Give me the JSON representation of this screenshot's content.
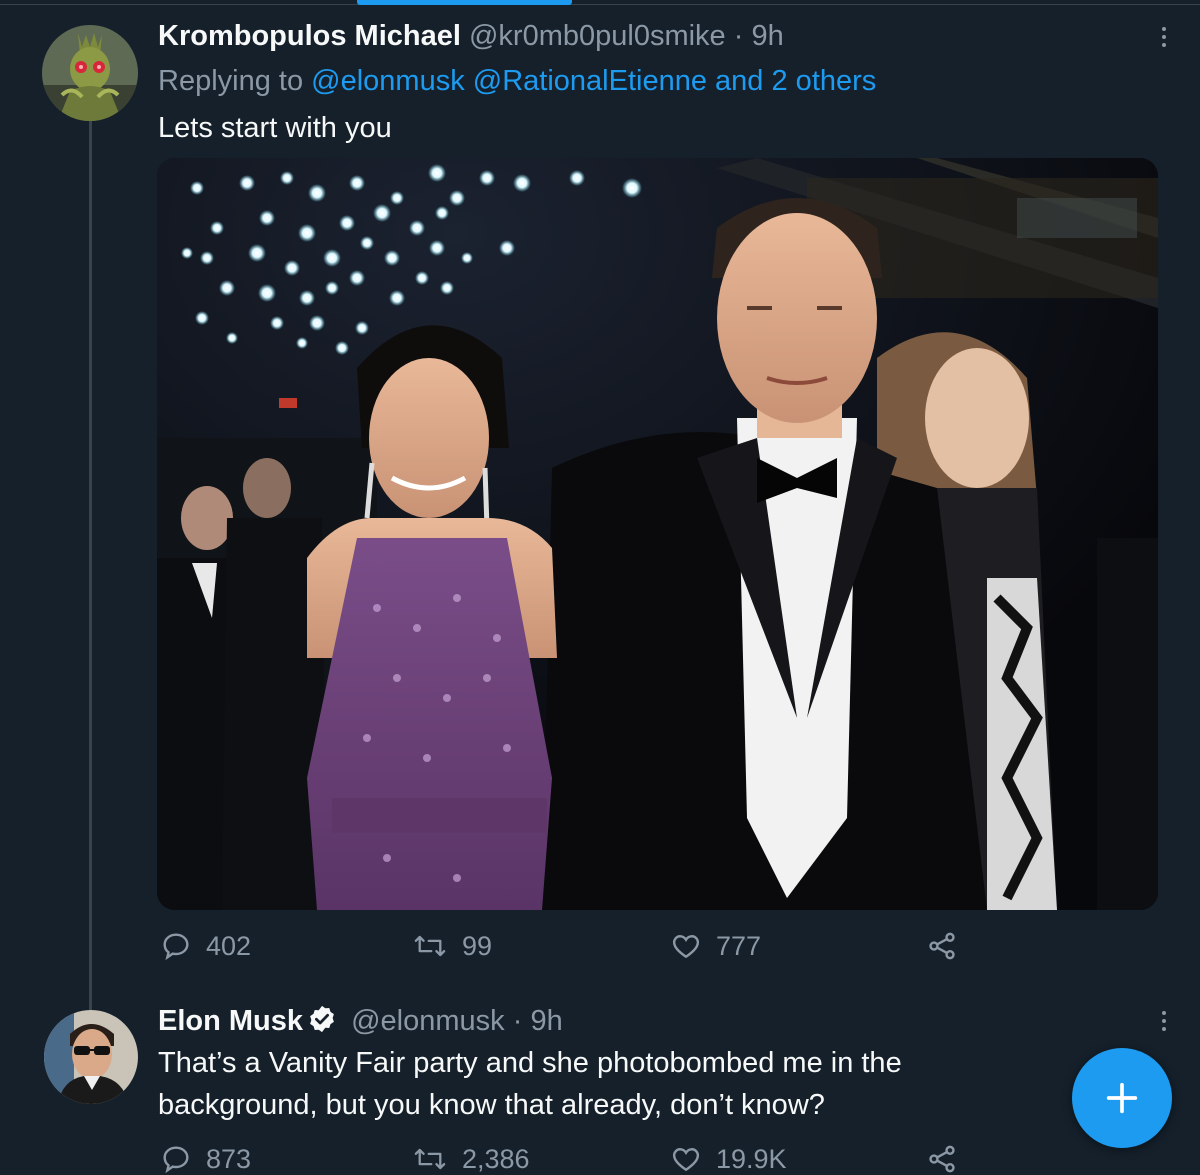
{
  "tweet1": {
    "display_name": "Krombopulos Michael",
    "handle": "@kr0mb0pul0smike",
    "separator": "·",
    "time": "9h",
    "replying_prefix": "Replying to",
    "replying_mention1": "@elonmusk",
    "replying_mention2": "@RationalEtienne",
    "replying_and": "and",
    "replying_others": "2 others",
    "text": "Lets start with you",
    "stats": {
      "replies": "402",
      "retweets": "99",
      "likes": "777"
    }
  },
  "tweet2": {
    "display_name": "Elon Musk",
    "handle": "@elonmusk",
    "separator": "·",
    "time": "9h",
    "text_line1": "That’s a Vanity Fair party and she photobombed me in the",
    "text_line2": "background, but you know that already, don’t know?",
    "stats": {
      "replies": "873",
      "retweets": "2,386",
      "likes": "19.9K"
    }
  },
  "icons": {
    "reply": "speech-bubble-icon",
    "retweet": "retweet-arrows-icon",
    "like": "heart-icon",
    "share": "share-nodes-icon",
    "more": "vertical-dots-icon",
    "verified": "verified-badge-icon",
    "compose": "plus-icon"
  },
  "colors": {
    "background": "#15202b",
    "accent": "#1d9bf0",
    "text_primary": "#f7f9f9",
    "text_secondary": "#8b98a5",
    "divider": "#38444d"
  }
}
